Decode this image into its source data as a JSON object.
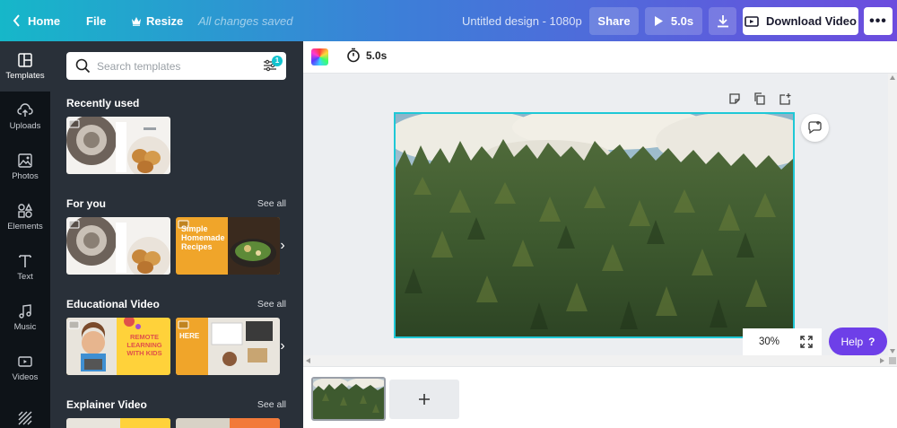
{
  "topbar": {
    "home_label": "Home",
    "file_label": "File",
    "resize_label": "Resize",
    "saved_status": "All changes saved",
    "design_title": "Untitled design - 1080p",
    "share_label": "Share",
    "play_duration": "5.0s",
    "download_label": "Download Video",
    "more_label": "•••"
  },
  "rail": {
    "items": [
      {
        "label": "Templates",
        "icon": "templates-icon",
        "active": true
      },
      {
        "label": "Uploads",
        "icon": "upload-cloud-icon"
      },
      {
        "label": "Photos",
        "icon": "photo-icon"
      },
      {
        "label": "Elements",
        "icon": "elements-icon"
      },
      {
        "label": "Text",
        "icon": "text-icon"
      },
      {
        "label": "Music",
        "icon": "music-note-icon"
      },
      {
        "label": "Videos",
        "icon": "video-icon"
      }
    ]
  },
  "panel": {
    "search_placeholder": "Search templates",
    "filter_badge": "1",
    "sections": [
      {
        "title": "Recently used",
        "see_all": ""
      },
      {
        "title": "For you",
        "see_all": "See all"
      },
      {
        "title": "Educational Video",
        "see_all": "See all"
      },
      {
        "title": "Explainer Video",
        "see_all": "See all"
      }
    ],
    "thumb_texts": {
      "recipes": "Simple Homemade Recipes",
      "remote": "REMOTE LEARNING WITH KIDS",
      "here": "HERE"
    }
  },
  "editor": {
    "timer": "5.0s",
    "zoom": "30%",
    "help_label": "Help",
    "help_icon": "?"
  },
  "colors": {
    "accent": "#1fc8d6",
    "help_purple": "#6e3fe8",
    "panel_bg": "#293039",
    "rail_bg": "#0e1318"
  }
}
